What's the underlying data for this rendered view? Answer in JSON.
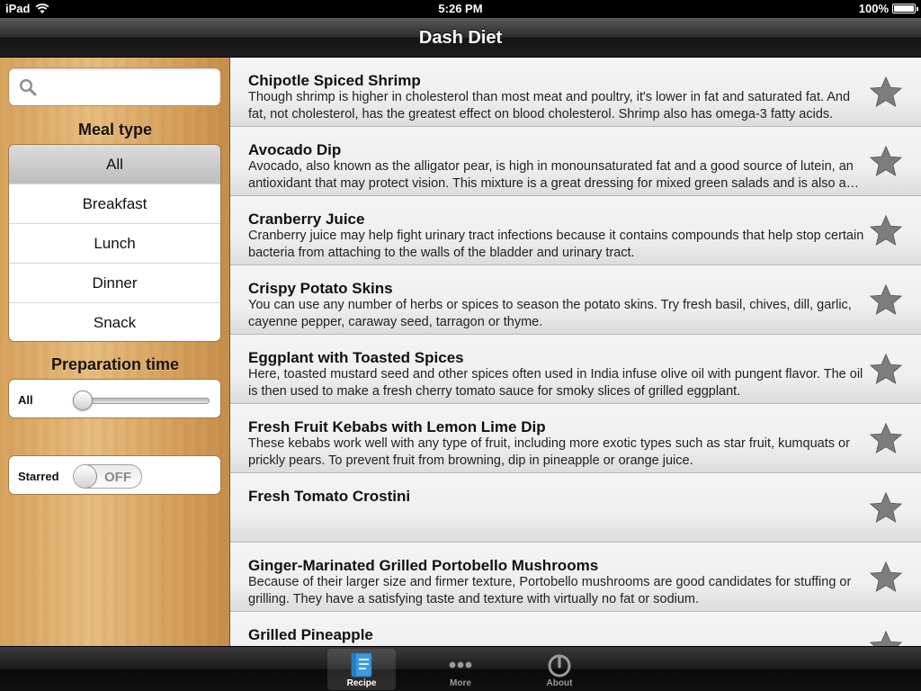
{
  "status_bar": {
    "device": "iPad",
    "time": "5:26 PM",
    "battery": "100%",
    "battery_level": 1.0
  },
  "nav": {
    "title": "Dash Diet"
  },
  "sidebar": {
    "search": {
      "value": "",
      "placeholder": ""
    },
    "meal_type_title": "Meal type",
    "meal_types": [
      {
        "label": "All",
        "selected": true
      },
      {
        "label": "Breakfast",
        "selected": false
      },
      {
        "label": "Lunch",
        "selected": false
      },
      {
        "label": "Dinner",
        "selected": false
      },
      {
        "label": "Snack",
        "selected": false
      }
    ],
    "prep_time_title": "Preparation time",
    "prep_time": {
      "label": "All",
      "slider_value": 0
    },
    "starred": {
      "label": "Starred",
      "state": "OFF"
    }
  },
  "recipes": [
    {
      "title": "Chipotle Spiced Shrimp",
      "description": "Though shrimp is higher in cholesterol than most meat and poultry, it's lower in fat and saturated fat. And fat, not cholesterol, has the greatest effect on blood cholesterol. Shrimp also has omega-3 fatty acids."
    },
    {
      "title": "Avocado Dip",
      "description": "Avocado, also known as the alligator pear, is high in monounsaturated fat and a good source of lutein, an antioxidant that may protect vision. This mixture is a great dressing for mixed green salads and is also a dip."
    },
    {
      "title": "Cranberry Juice",
      "description": "Cranberry juice may help fight urinary tract infections because it contains compounds that help stop certain bacteria from attaching to the walls of the bladder and urinary tract."
    },
    {
      "title": "Crispy Potato Skins",
      "description": "You can use any number of herbs or spices to season the potato skins. Try fresh basil, chives, dill, garlic, cayenne pepper, caraway seed, tarragon or thyme."
    },
    {
      "title": "Eggplant with Toasted Spices",
      "description": "Here, toasted mustard seed and other spices often used in India infuse olive oil with pungent flavor. The oil is then used to make a fresh cherry tomato sauce for smoky slices of grilled eggplant."
    },
    {
      "title": "Fresh Fruit Kebabs with Lemon Lime Dip",
      "description": "These kebabs work well with any type of fruit, including more exotic types such as star fruit, kumquats or prickly pears. To prevent fruit from browning, dip in pineapple or orange juice."
    },
    {
      "title": "Fresh Tomato Crostini",
      "description": ""
    },
    {
      "title": "Ginger-Marinated Grilled Portobello Mushrooms",
      "description": "Because of their larger size and firmer texture, Portobello mushrooms are good candidates for stuffing or grilling. They have a satisfying taste and texture with virtually no fat or sodium."
    },
    {
      "title": "Grilled Pineapple",
      "description": ""
    }
  ],
  "tabs": [
    {
      "label": "Recipe",
      "icon": "recipe-book-icon",
      "active": true
    },
    {
      "label": "More",
      "icon": "more-dots-icon",
      "active": false
    },
    {
      "label": "About",
      "icon": "power-icon",
      "active": false
    }
  ],
  "colors": {
    "accent_blue": "#2f8fd8",
    "star_gray": "#7d7d7d",
    "wood": "#e0b06e"
  }
}
